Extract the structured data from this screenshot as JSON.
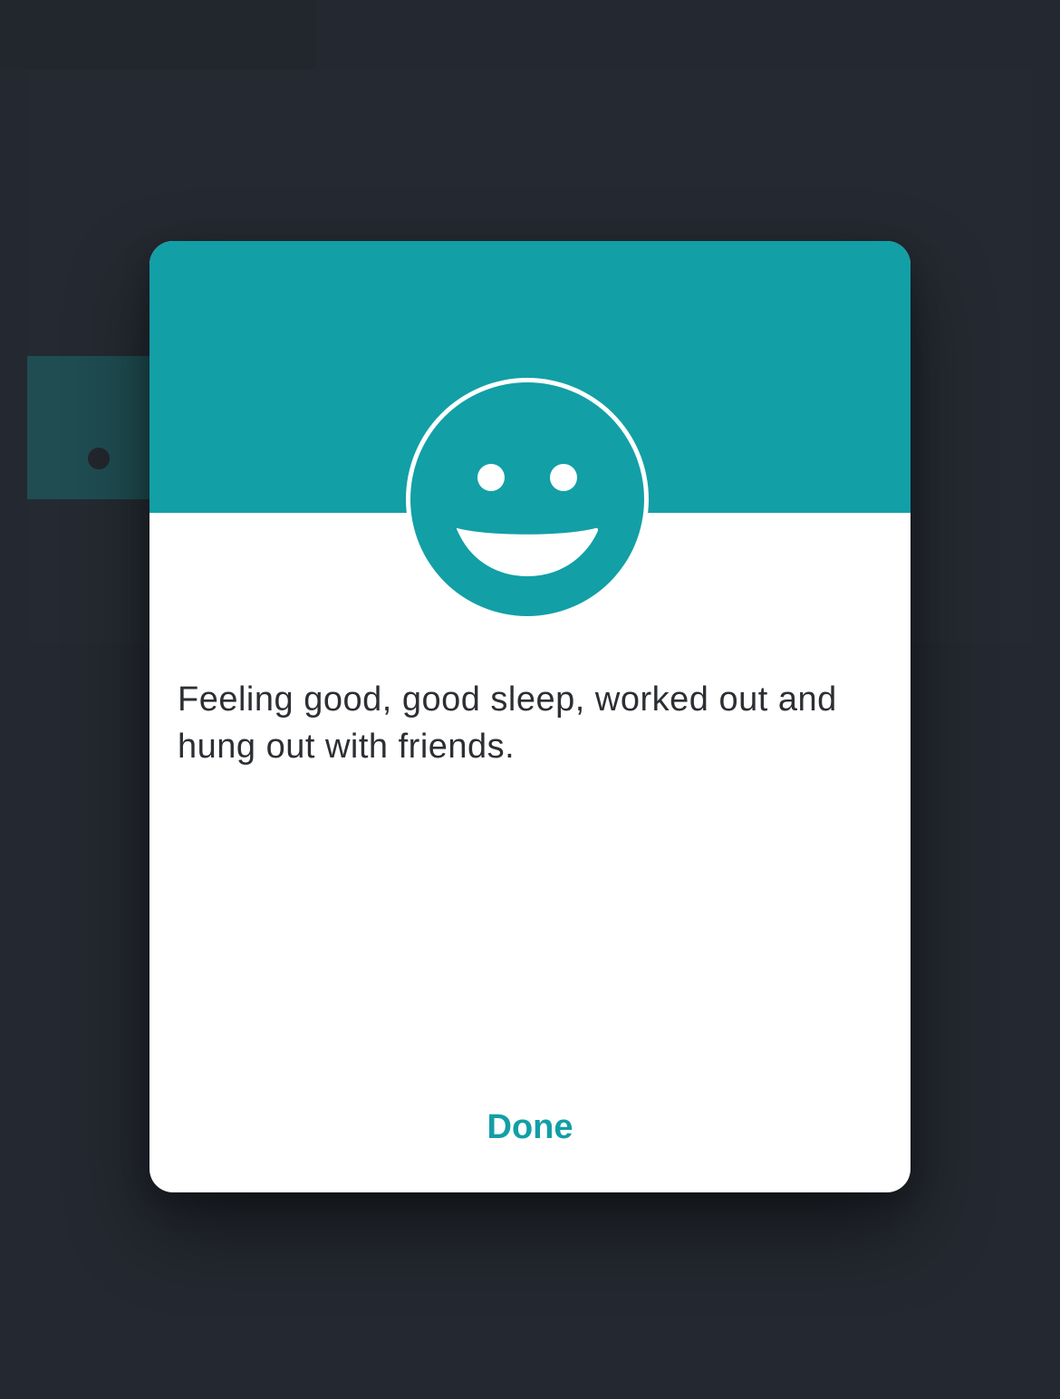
{
  "background": {
    "accent_color": "#1f4d52",
    "base_color": "#242830"
  },
  "modal": {
    "header_color": "#129fa6",
    "mood_icon": "smiley-face-icon",
    "entry_text": "Feeling good, good sleep, worked out and hung out with friends.",
    "done_label": "Done"
  }
}
